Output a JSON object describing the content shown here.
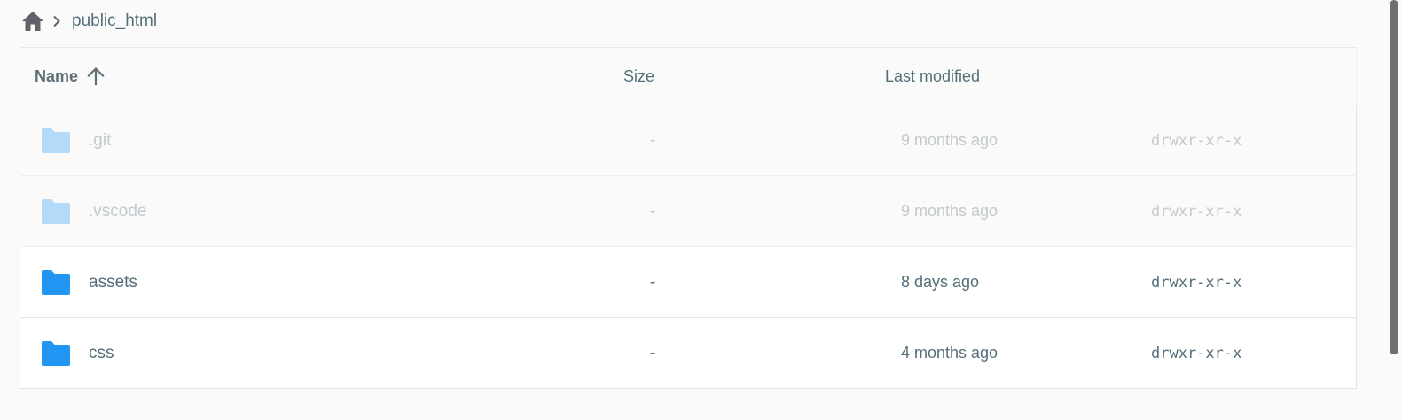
{
  "breadcrumb": {
    "home_icon": "home-icon",
    "separator_icon": "chevron-right-icon",
    "current": "public_html"
  },
  "table": {
    "headers": {
      "name": "Name",
      "size": "Size",
      "modified": "Last modified",
      "sort_icon": "arrow-up-icon"
    },
    "rows": [
      {
        "name": ".git",
        "size": "-",
        "modified": "9 months ago",
        "permissions": "drwxr-xr-x",
        "hidden": true
      },
      {
        "name": ".vscode",
        "size": "-",
        "modified": "9 months ago",
        "permissions": "drwxr-xr-x",
        "hidden": true
      },
      {
        "name": "assets",
        "size": "-",
        "modified": "8 days ago",
        "permissions": "drwxr-xr-x",
        "hidden": false
      },
      {
        "name": "css",
        "size": "-",
        "modified": "4 months ago",
        "permissions": "drwxr-xr-x",
        "hidden": false
      }
    ]
  },
  "colors": {
    "folder": "#2196f3",
    "folder_dim": "#b3daf8",
    "text": "#546e7a",
    "text_dim": "#c3c9cc"
  }
}
